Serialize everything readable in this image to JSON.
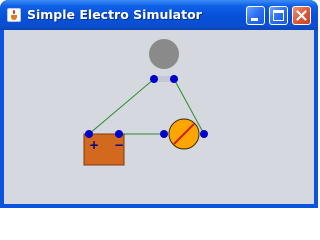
{
  "window": {
    "title": "Simple Electro Simulator",
    "app_icon": "java-cup-icon",
    "controls": {
      "minimize": "minimize-icon",
      "maximize": "maximize-icon",
      "close": "close-icon"
    }
  },
  "circuit": {
    "battery": {
      "plus_label": "+",
      "minus_label": "−",
      "color": "#d2691e"
    },
    "lamp": {
      "state": "on",
      "color": "#ffa500"
    },
    "idle_component": {
      "color": "#8a8a8a"
    },
    "terminal_color": "#0000cc",
    "wire_color": "#2a8a2a",
    "background": "#d6d8df"
  }
}
